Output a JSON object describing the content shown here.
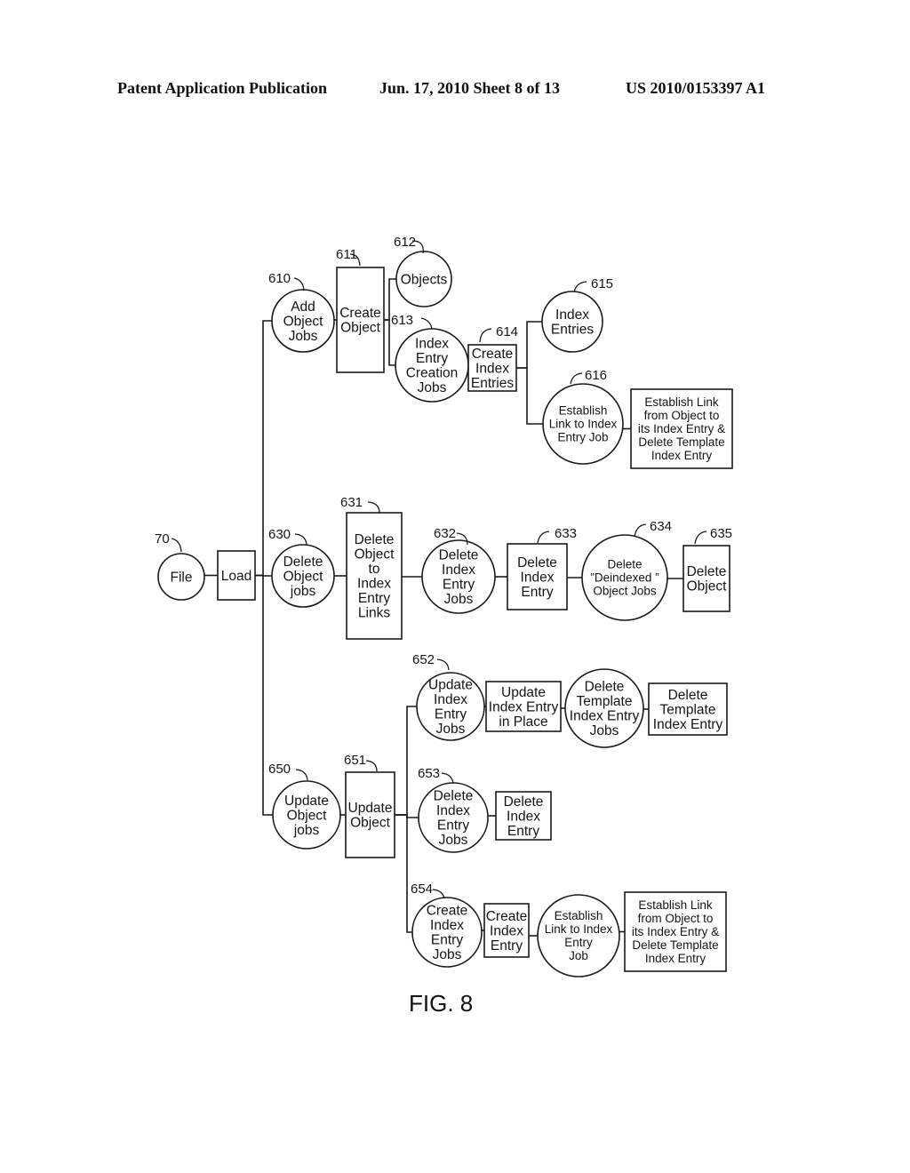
{
  "header": {
    "publication": "Patent Application Publication",
    "date_sheet": "Jun. 17, 2010  Sheet 8 of 13",
    "number": "US 2010/0153397 A1"
  },
  "figure_caption": "FIG. 8",
  "nodes": [
    {
      "id": "file",
      "ref": "70",
      "shape": "circle",
      "lines": [
        "File"
      ]
    },
    {
      "id": "load",
      "ref": "",
      "shape": "rect",
      "lines": [
        "Load"
      ]
    },
    {
      "id": "add-object-jobs",
      "ref": "610",
      "shape": "circle",
      "lines": [
        "Add",
        "Object",
        "Jobs"
      ]
    },
    {
      "id": "create-object",
      "ref": "611",
      "shape": "rect",
      "lines": [
        "Create",
        "Object"
      ]
    },
    {
      "id": "objects",
      "ref": "612",
      "shape": "circle",
      "lines": [
        "Objects"
      ]
    },
    {
      "id": "index-entry-creation-jobs",
      "ref": "613",
      "shape": "circle",
      "lines": [
        "Index",
        "Entry",
        "Creation",
        "Jobs"
      ]
    },
    {
      "id": "create-index-entries",
      "ref": "614",
      "shape": "rect",
      "lines": [
        "Create",
        "Index",
        "Entries"
      ]
    },
    {
      "id": "index-entries",
      "ref": "615",
      "shape": "circle",
      "lines": [
        "Index",
        "Entries"
      ]
    },
    {
      "id": "establish-link-job-616",
      "ref": "616",
      "shape": "circle",
      "lines": [
        "Establish",
        "Link to Index",
        "Entry Job"
      ]
    },
    {
      "id": "establish-link-action-616",
      "ref": "",
      "shape": "rect",
      "lines": [
        "Establish Link",
        "from Object to",
        "its Index Entry &",
        "Delete Template",
        "Index Entry"
      ]
    },
    {
      "id": "delete-object-jobs",
      "ref": "630",
      "shape": "circle",
      "lines": [
        "Delete",
        "Object",
        "jobs"
      ]
    },
    {
      "id": "delete-object-to-index-links",
      "ref": "631",
      "shape": "rect",
      "lines": [
        "Delete",
        "Object",
        "to",
        "Index",
        "Entry",
        "Links"
      ]
    },
    {
      "id": "delete-index-entry-jobs-632",
      "ref": "632",
      "shape": "circle",
      "lines": [
        "Delete",
        "Index",
        "Entry",
        "Jobs"
      ]
    },
    {
      "id": "delete-index-entry-633",
      "ref": "633",
      "shape": "rect",
      "lines": [
        "Delete",
        "Index",
        "Entry"
      ]
    },
    {
      "id": "delete-deindexed-object-jobs",
      "ref": "634",
      "shape": "circle",
      "lines": [
        "Delete",
        "”Deindexed ”",
        "Object Jobs"
      ]
    },
    {
      "id": "delete-object-635",
      "ref": "635",
      "shape": "rect",
      "lines": [
        "Delete",
        "Object"
      ]
    },
    {
      "id": "update-object-jobs",
      "ref": "650",
      "shape": "circle",
      "lines": [
        "Update",
        "Object",
        "jobs"
      ]
    },
    {
      "id": "update-object",
      "ref": "651",
      "shape": "rect",
      "lines": [
        "Update",
        "Object"
      ]
    },
    {
      "id": "update-index-entry-jobs",
      "ref": "652",
      "shape": "circle",
      "lines": [
        "Update",
        "Index",
        "Entry",
        "Jobs"
      ]
    },
    {
      "id": "update-index-entry-in-place",
      "ref": "",
      "shape": "rect",
      "lines": [
        "Update",
        "Index Entry",
        "in Place"
      ]
    },
    {
      "id": "delete-template-index-entry-jobs",
      "ref": "",
      "shape": "circle",
      "lines": [
        "Delete",
        "Template",
        "Index Entry",
        "Jobs"
      ]
    },
    {
      "id": "delete-template-index-entry",
      "ref": "",
      "shape": "rect",
      "lines": [
        "Delete",
        "Template",
        "Index Entry"
      ]
    },
    {
      "id": "delete-index-entry-jobs-653",
      "ref": "653",
      "shape": "circle",
      "lines": [
        "Delete",
        "Index",
        "Entry",
        "Jobs"
      ]
    },
    {
      "id": "delete-index-entry-653",
      "ref": "",
      "shape": "rect",
      "lines": [
        "Delete",
        "Index",
        "Entry"
      ]
    },
    {
      "id": "create-index-entry-jobs",
      "ref": "654",
      "shape": "circle",
      "lines": [
        "Create",
        "Index",
        "Entry",
        "Jobs"
      ]
    },
    {
      "id": "create-index-entry",
      "ref": "",
      "shape": "rect",
      "lines": [
        "Create",
        "Index",
        "Entry"
      ]
    },
    {
      "id": "establish-link-job-654",
      "ref": "",
      "shape": "circle",
      "lines": [
        "Establish",
        "Link to Index",
        "Entry",
        "Job"
      ]
    },
    {
      "id": "establish-link-action-654",
      "ref": "",
      "shape": "rect",
      "lines": [
        "Establish Link",
        "from Object to",
        "its Index Entry &",
        "Delete Template",
        "Index Entry"
      ]
    }
  ],
  "edges": [
    [
      "file",
      "load"
    ],
    [
      "load",
      "add-object-jobs"
    ],
    [
      "load",
      "delete-object-jobs"
    ],
    [
      "load",
      "update-object-jobs"
    ],
    [
      "add-object-jobs",
      "create-object"
    ],
    [
      "create-object",
      "objects"
    ],
    [
      "create-object",
      "index-entry-creation-jobs"
    ],
    [
      "index-entry-creation-jobs",
      "create-index-entries"
    ],
    [
      "create-index-entries",
      "index-entries"
    ],
    [
      "create-index-entries",
      "establish-link-job-616"
    ],
    [
      "establish-link-job-616",
      "establish-link-action-616"
    ],
    [
      "delete-object-jobs",
      "delete-object-to-index-links"
    ],
    [
      "delete-object-to-index-links",
      "delete-index-entry-jobs-632"
    ],
    [
      "delete-index-entry-jobs-632",
      "delete-index-entry-633"
    ],
    [
      "delete-index-entry-633",
      "delete-deindexed-object-jobs"
    ],
    [
      "delete-deindexed-object-jobs",
      "delete-object-635"
    ],
    [
      "update-object-jobs",
      "update-object"
    ],
    [
      "update-object",
      "update-index-entry-jobs"
    ],
    [
      "update-object",
      "delete-index-entry-jobs-653"
    ],
    [
      "update-object",
      "create-index-entry-jobs"
    ],
    [
      "update-index-entry-jobs",
      "update-index-entry-in-place"
    ],
    [
      "update-index-entry-in-place",
      "delete-template-index-entry-jobs"
    ],
    [
      "delete-template-index-entry-jobs",
      "delete-template-index-entry"
    ],
    [
      "delete-index-entry-jobs-653",
      "delete-index-entry-653"
    ],
    [
      "create-index-entry-jobs",
      "create-index-entry"
    ],
    [
      "create-index-entry",
      "establish-link-job-654"
    ],
    [
      "establish-link-job-654",
      "establish-link-action-654"
    ]
  ]
}
